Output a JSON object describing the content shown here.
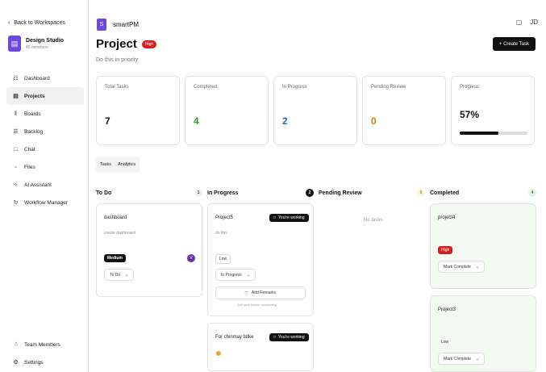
{
  "sidebar": {
    "back_label": "Back to Workspaces",
    "workspace": {
      "initial": "▤",
      "name": "Design Studio",
      "members": "45 members"
    },
    "items": [
      {
        "label": "Dashboard",
        "icon": "☷"
      },
      {
        "label": "Projects",
        "icon": "▤"
      },
      {
        "label": "Boards",
        "icon": "‖"
      },
      {
        "label": "Backlog",
        "icon": "☰"
      },
      {
        "label": "Chat",
        "icon": "□"
      },
      {
        "label": "Files",
        "icon": "▫"
      },
      {
        "label": "AI Assistant",
        "icon": "✧"
      },
      {
        "label": "Workflow Manager",
        "icon": "↻"
      }
    ],
    "bottom": [
      {
        "label": "Team Members",
        "icon": "☃"
      },
      {
        "label": "Settings",
        "icon": "⚙"
      }
    ]
  },
  "topbar": {
    "logo": "S",
    "brand": "smartPM",
    "bell_icon": "▢",
    "user_initials": "JD"
  },
  "project": {
    "title": "Project",
    "priority": "High",
    "description": "Do this in priority",
    "create_label": "+ Create Task"
  },
  "stats": [
    {
      "label": "Total Tasks",
      "value": "7",
      "color": "#111111"
    },
    {
      "label": "Completed",
      "value": "4",
      "color": "#2e9a3a"
    },
    {
      "label": "In Progress",
      "value": "2",
      "color": "#2f62c8"
    },
    {
      "label": "Pending Review",
      "value": "0",
      "color": "#c08a00"
    },
    {
      "label": "Progress",
      "value": "57%",
      "color": "#111111"
    }
  ],
  "progress_fraction": 0.57,
  "tabs": [
    "Tasks",
    "Analytics"
  ],
  "columns": {
    "todo": {
      "title": "To Do",
      "count": "1"
    },
    "inprogress": {
      "title": "In Progress",
      "count": "2"
    },
    "pending": {
      "title": "Pending Review",
      "count": "0",
      "empty": "No tasks"
    },
    "completed": {
      "title": "Completed",
      "count": "4"
    }
  },
  "cards": {
    "dashboard": {
      "title": "dashboard",
      "desc": "create dashboard",
      "priority": "Medium",
      "status": "To Do",
      "avatar": "V"
    },
    "project5": {
      "title": "Project5",
      "desc": "do this",
      "working": "You're working",
      "priority": "Low",
      "status": "In Progress",
      "remarks": "Add Remarks",
      "hint": "Add your before completing"
    },
    "chinmay": {
      "title": "For chinmay tidke",
      "working": "You're working"
    },
    "project4": {
      "title": "project4",
      "priority": "High",
      "action": "Mark Complete"
    },
    "project3": {
      "title": "Project3",
      "priority": "Low",
      "action": "Mark Complete"
    }
  }
}
